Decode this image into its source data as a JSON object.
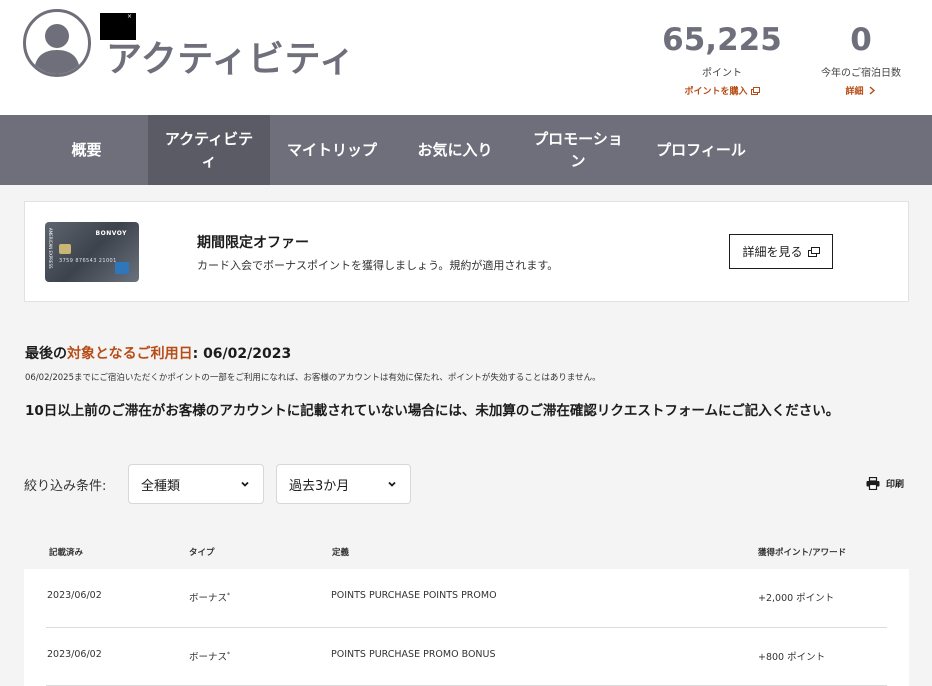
{
  "header": {
    "title": "アクティビティ",
    "points": {
      "value": "65,225",
      "label": "ポイント",
      "link": "ポイントを購入"
    },
    "nights": {
      "value": "0",
      "label": "今年のご宿泊日数",
      "link": "詳細"
    }
  },
  "nav": {
    "items": [
      {
        "label": "概要"
      },
      {
        "label": "アクティビテ\nィ"
      },
      {
        "label": "マイトリップ"
      },
      {
        "label": "お気に入り"
      },
      {
        "label": "プロモーショ\nン"
      },
      {
        "label": "プロフィール"
      }
    ]
  },
  "offer": {
    "title": "期間限定オファー",
    "description": "カード入会でボーナスポイントを獲得しましょう。規約が適用されます。",
    "button": "詳細を見る"
  },
  "last_activity": {
    "prefix": "最後の",
    "highlight": "対象となるご利用日",
    "suffix": ": 06/02/2023",
    "note": "06/02/2025までにご宿泊いただくかポイントの一部をご利用になれば、お客様のアカウントは有効に保たれ、ポイントが失効することはありません。"
  },
  "warning": "10日以上前のご滞在がお客様のアカウントに記載されていない場合には、未加算のご滞在確認リクエストフォームにご記入ください。",
  "filters": {
    "label": "絞り込み条件:",
    "type_value": "全種類",
    "period_value": "過去3か月",
    "print": "印刷"
  },
  "table": {
    "headers": [
      "記載済み",
      "タイプ",
      "定義",
      "獲得ポイント/アワード"
    ],
    "rows": [
      {
        "date": "2023/06/02",
        "type": "ボーナス",
        "mark": "*",
        "definition": "POINTS PURCHASE POINTS PROMO",
        "points": "+2,000 ポイント"
      },
      {
        "date": "2023/06/02",
        "type": "ボーナス",
        "mark": "*",
        "definition": "POINTS PURCHASE PROMO BONUS",
        "points": "+800 ポイント"
      }
    ]
  },
  "colors": {
    "accent": "#b84c16",
    "nav_bg": "#6e6f7a",
    "nav_active": "#5a5b65"
  }
}
